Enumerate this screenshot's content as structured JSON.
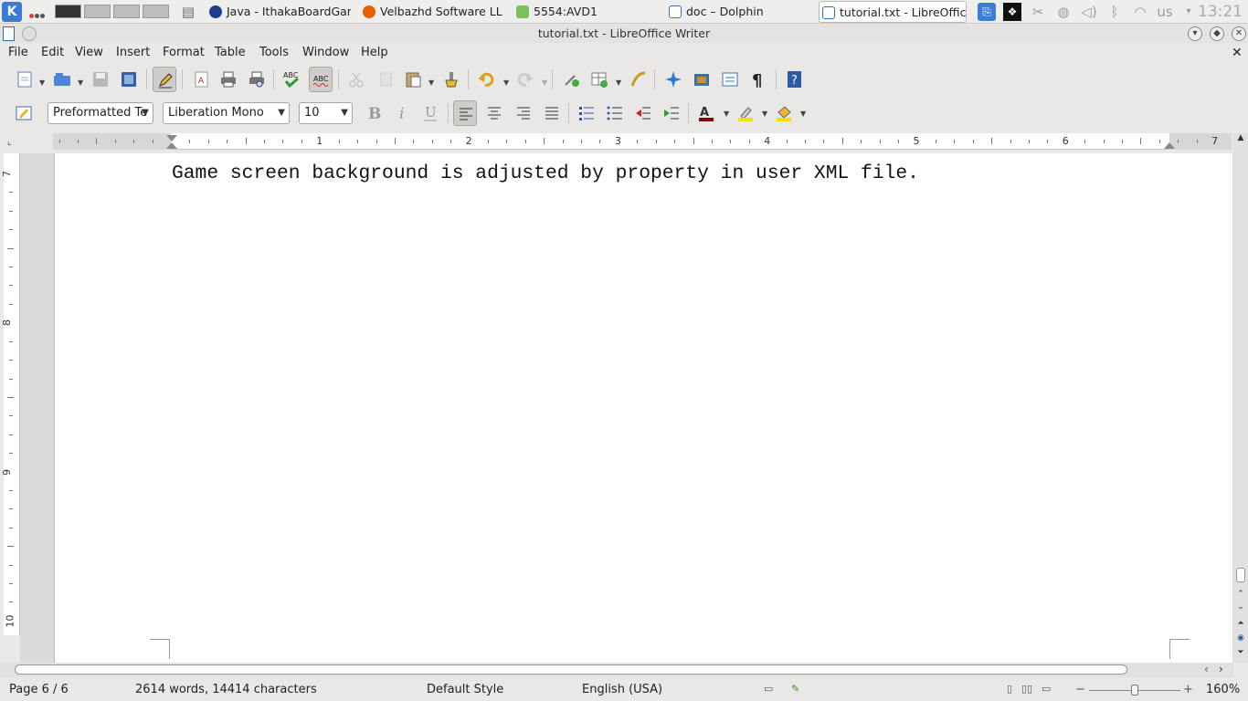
{
  "taskbar": {
    "tasks": [
      {
        "label": "Java - IthakaBoardGam",
        "icon_color": "#1d3c8f"
      },
      {
        "label": "Velbazhd Software LLC",
        "icon_color": "#e66000"
      },
      {
        "label": "5554:AVD1",
        "icon_color": "#78c257"
      },
      {
        "label": "doc – Dolphin",
        "icon_color": "#3b6fb6"
      },
      {
        "label": "tutorial.txt - LibreOffic",
        "icon_color": "#2a6ebb"
      }
    ],
    "keyboard_layout": "us",
    "clock": "13:21"
  },
  "window": {
    "title": "tutorial.txt - LibreOffice Writer"
  },
  "menus": [
    "File",
    "Edit",
    "View",
    "Insert",
    "Format",
    "Table",
    "Tools",
    "Window",
    "Help"
  ],
  "formatting": {
    "paragraph_style": "Preformatted Te",
    "font_name": "Liberation Mono",
    "font_size": "10"
  },
  "ruler": {
    "h_labels": [
      "1",
      "2",
      "3",
      "4",
      "5",
      "6",
      "7"
    ],
    "v_labels": [
      "7",
      "8",
      "9",
      "10"
    ]
  },
  "document": {
    "text": "Game screen background is adjusted by property in user XML file."
  },
  "status": {
    "page": "Page 6 / 6",
    "word_count": "2614 words, 14414 characters",
    "page_style": "Default Style",
    "language": "English (USA)",
    "zoom": "160%",
    "zoom_fraction": 0.5
  },
  "icons": {
    "edit_mode": "pencil-icon",
    "spellcheck": "abc-check-icon"
  }
}
